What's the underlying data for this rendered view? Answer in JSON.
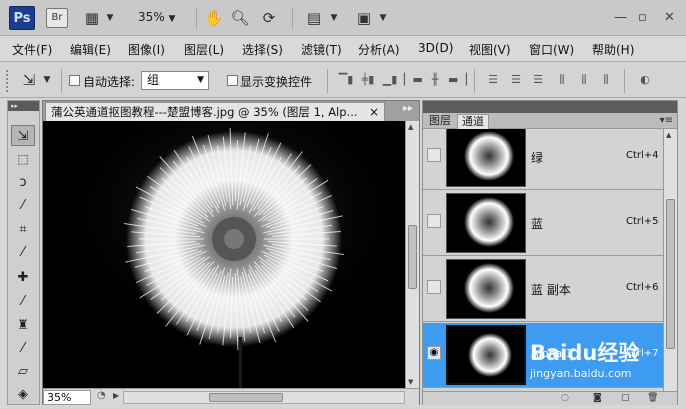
{
  "appbar": {
    "app_logo": "Ps",
    "bridge_logo": "Br",
    "zoom": "35%",
    "icons": [
      "screen-mode-icon",
      "hand-icon",
      "zoom-icon",
      "rotate-view-icon",
      "arrange-documents-icon",
      "screen-mode-icon"
    ],
    "window_controls": [
      "minimize-icon",
      "restore-icon",
      "close-icon"
    ]
  },
  "menu": [
    "文件(F)",
    "编辑(E)",
    "图像(I)",
    "图层(L)",
    "选择(S)",
    "滤镜(T)",
    "分析(A)",
    "3D(D)",
    "视图(V)",
    "窗口(W)",
    "帮助(H)"
  ],
  "options": {
    "auto_select_label": "自动选择:",
    "auto_select_value": "组",
    "show_transform_label": "显示变换控件"
  },
  "document": {
    "title": "蒲公英通道抠图教程---楚盟博客.jpg @ 35% (图层 1, Alp...",
    "zoom": "35%"
  },
  "panel": {
    "tabs": [
      "图层",
      "通道"
    ],
    "active_tab": "通道",
    "channels": [
      {
        "name": "绿",
        "shortcut": "Ctrl+4",
        "visible": false,
        "selected": false
      },
      {
        "name": "蓝",
        "shortcut": "Ctrl+5",
        "visible": false,
        "selected": false
      },
      {
        "name": "蓝 副本",
        "shortcut": "Ctrl+6",
        "visible": false,
        "selected": false
      },
      {
        "name": "Alpha 1",
        "shortcut": "Ctrl+7",
        "visible": true,
        "selected": true
      }
    ]
  },
  "watermark": {
    "brand": "Baidu经验",
    "url": "jingyan.baidu.com"
  },
  "colors": {
    "selection": "#3d9bf0",
    "ps_logo": "#1b3f8f",
    "canvas": "#000000"
  }
}
